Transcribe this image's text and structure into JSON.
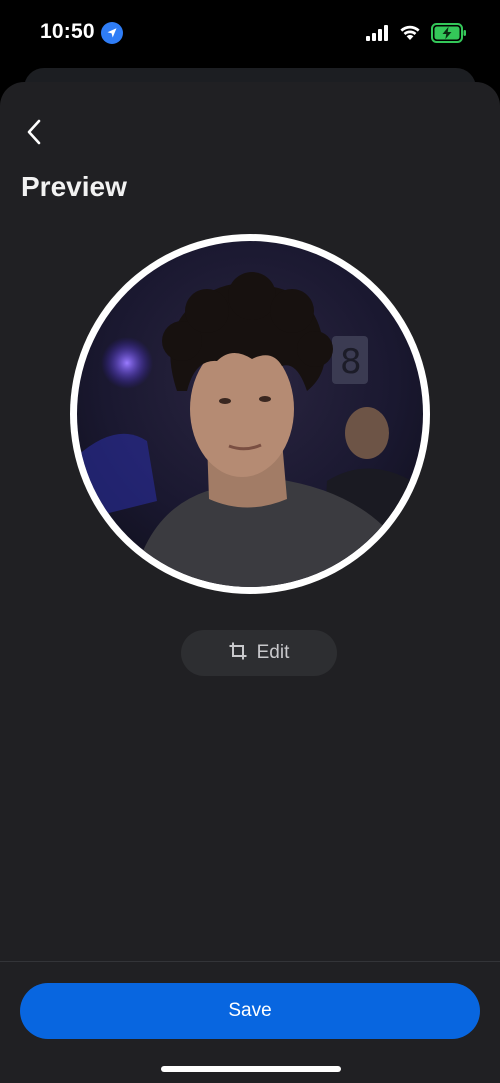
{
  "status_bar": {
    "time": "10:50",
    "location_icon": "location-arrow-icon",
    "signal_icon": "cellular-signal-icon",
    "wifi_icon": "wifi-icon",
    "battery_icon": "battery-charging-icon",
    "battery_color": "#34c759"
  },
  "header": {
    "back_icon": "chevron-left-icon",
    "title": "Preview"
  },
  "profile_photo": {
    "ring_color": "#ffffff"
  },
  "edit": {
    "icon": "crop-icon",
    "label": "Edit"
  },
  "footer": {
    "save_label": "Save",
    "accent_color": "#0866e0"
  }
}
